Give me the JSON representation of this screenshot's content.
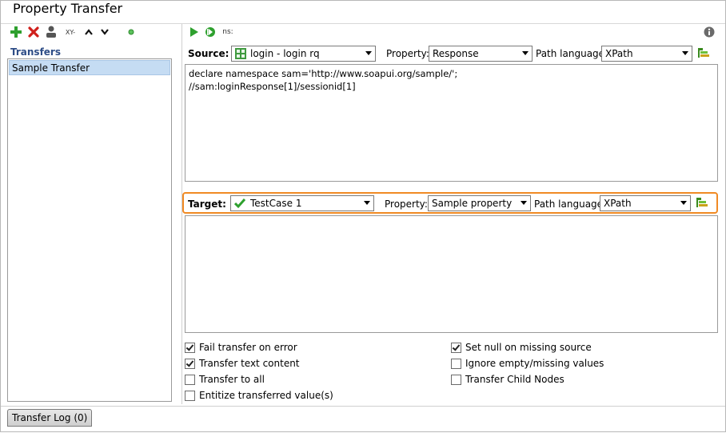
{
  "window": {
    "title": "Property Transfer"
  },
  "left_panel": {
    "toolbar": {
      "icons": [
        "add-icon",
        "delete-icon",
        "rename-icon",
        "xy-icon",
        "move-up-icon",
        "move-down-icon",
        "status-dot-icon"
      ],
      "xy_label": "XY-"
    },
    "heading": "Transfers",
    "items": [
      {
        "label": "Sample Transfer",
        "selected": true
      }
    ]
  },
  "right_panel": {
    "toolbar": {
      "icons": [
        "run-icon",
        "run-all-icon",
        "namespace-icon",
        "info-icon"
      ],
      "ns_label": "ns:"
    },
    "source": {
      "label": "Source:",
      "step_value": "login - login rq",
      "property_label": "Property:",
      "property_value": "Response",
      "path_language_label": "Path language:",
      "path_language_value": "XPath",
      "expression_lines": [
        "declare namespace sam='http://www.soapui.org/sample/';",
        "//sam:loginResponse[1]/sessionid[1]"
      ]
    },
    "target": {
      "label": "Target:",
      "step_value": "TestCase 1",
      "property_label": "Property:",
      "property_value": "Sample property",
      "path_language_label": "Path language:",
      "path_language_value": "XPath",
      "highlight_color": "#f08a24"
    },
    "options": {
      "left": [
        {
          "label": "Fail transfer on error",
          "checked": true
        },
        {
          "label": "Transfer text content",
          "checked": true
        },
        {
          "label": "Transfer to all",
          "checked": false
        },
        {
          "label": "Entitize transferred value(s)",
          "checked": false
        }
      ],
      "right": [
        {
          "label": "Set null on missing source",
          "checked": true
        },
        {
          "label": "Ignore empty/missing values",
          "checked": false
        },
        {
          "label": "Transfer Child Nodes",
          "checked": false
        }
      ]
    }
  },
  "bottom": {
    "log_tab_label": "Transfer Log (0)"
  },
  "colors": {
    "accent_green": "#2ea02e",
    "delete_red": "#d0201c",
    "heading_blue": "#2e4d87",
    "selection_bg": "#c5dcf3"
  }
}
